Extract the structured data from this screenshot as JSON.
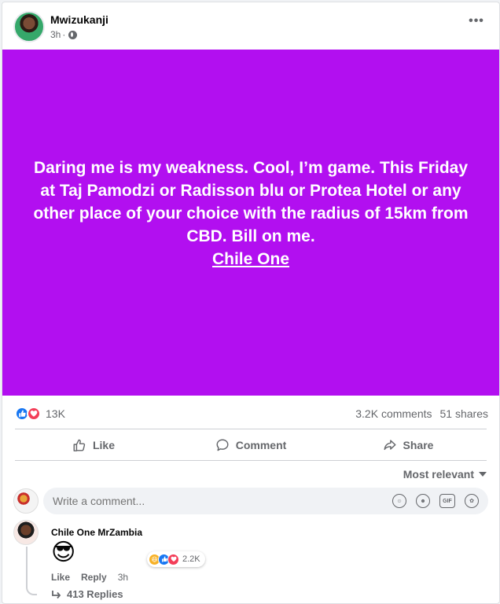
{
  "post": {
    "author": "Mwizukanji",
    "time": "3h",
    "privacy_icon": "globe-icon",
    "menu_icon": "more-icon",
    "background_color": "#b20ff0",
    "status_text": "Daring me is my weakness. Cool, I’m game. This Friday at Taj Pamodzi or Radisson blu or Protea Hotel or any other place of your choice with the radius of 15km from CBD. Bill on me.",
    "mention": "Chile One"
  },
  "stats": {
    "reaction_icons": [
      "like-icon",
      "love-icon"
    ],
    "reaction_count": "13K",
    "comments": "3.2K comments",
    "shares": "51 shares"
  },
  "actions": {
    "like": "Like",
    "comment": "Comment",
    "share": "Share"
  },
  "comments_section": {
    "sort_label": "Most relevant",
    "composer_placeholder": "Write a comment...",
    "composer_icons": [
      "avatar-sticker-icon",
      "emoji-icon",
      "gif-icon",
      "sticker-icon"
    ]
  },
  "comment": {
    "author": "Chile One MrZambia",
    "sticker": "😎",
    "reaction_icons": [
      "haha-icon",
      "like-icon",
      "love-icon"
    ],
    "reaction_count": "2.2K",
    "like_label": "Like",
    "reply_label": "Reply",
    "time": "3h",
    "replies_label": "413 Replies"
  },
  "colors": {
    "accent": "#1877f2",
    "love": "#f33e58",
    "muted": "#65676b"
  }
}
